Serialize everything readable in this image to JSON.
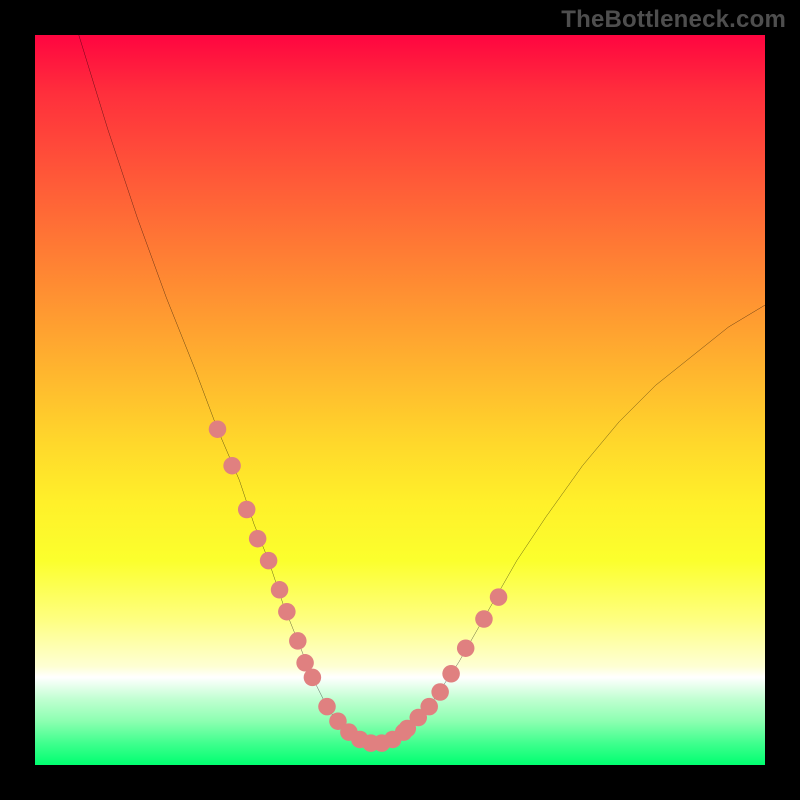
{
  "watermark": "TheBottleneck.com",
  "chart_data": {
    "type": "line",
    "title": "",
    "xlabel": "",
    "ylabel": "",
    "xlim": [
      0,
      100
    ],
    "ylim": [
      0,
      100
    ],
    "gradient_stops": [
      {
        "pos": 0,
        "color": "#ff0540"
      },
      {
        "pos": 8,
        "color": "#ff2f3c"
      },
      {
        "pos": 20,
        "color": "#ff5a38"
      },
      {
        "pos": 32,
        "color": "#ff8433"
      },
      {
        "pos": 44,
        "color": "#ffae2f"
      },
      {
        "pos": 56,
        "color": "#ffd82b"
      },
      {
        "pos": 64,
        "color": "#fff02a"
      },
      {
        "pos": 72,
        "color": "#fbff2d"
      },
      {
        "pos": 80,
        "color": "#feff80"
      },
      {
        "pos": 86.5,
        "color": "#feffd4"
      },
      {
        "pos": 88,
        "color": "#ffffff"
      },
      {
        "pos": 89,
        "color": "#eaffef"
      },
      {
        "pos": 91,
        "color": "#c0ffd1"
      },
      {
        "pos": 94,
        "color": "#8cffb1"
      },
      {
        "pos": 97,
        "color": "#40ff8e"
      },
      {
        "pos": 100,
        "color": "#00ff70"
      }
    ],
    "series": [
      {
        "name": "curve",
        "x": [
          6,
          10,
          14,
          18,
          22,
          25,
          28,
          30,
          32,
          34,
          36,
          38,
          40,
          42,
          44,
          46,
          50,
          54,
          58,
          62,
          66,
          70,
          75,
          80,
          85,
          90,
          95,
          100
        ],
        "y": [
          100,
          87,
          75,
          64,
          54,
          46,
          39,
          33,
          28,
          22,
          17,
          12,
          8,
          5,
          3,
          3,
          4,
          8,
          14,
          21,
          28,
          34,
          41,
          47,
          52,
          56,
          60,
          63
        ]
      },
      {
        "name": "highlight-left",
        "x": [
          25,
          27,
          29,
          30.5,
          32,
          33.5,
          34.5,
          36,
          37,
          38
        ],
        "y": [
          46,
          41,
          35,
          31,
          28,
          24,
          21,
          17,
          14,
          12
        ]
      },
      {
        "name": "highlight-bottom",
        "x": [
          40,
          41.5,
          43,
          44.5,
          46,
          47.5,
          49,
          50.5
        ],
        "y": [
          8,
          6,
          4.5,
          3.5,
          3,
          3,
          3.5,
          4.5
        ]
      },
      {
        "name": "highlight-right",
        "x": [
          51,
          52.5,
          54,
          55.5,
          57,
          59,
          61.5,
          63.5
        ],
        "y": [
          5,
          6.5,
          8,
          10,
          12.5,
          16,
          20,
          23
        ]
      }
    ],
    "highlight_style": {
      "color": "#e08080",
      "radius_pct": 1.2
    }
  }
}
